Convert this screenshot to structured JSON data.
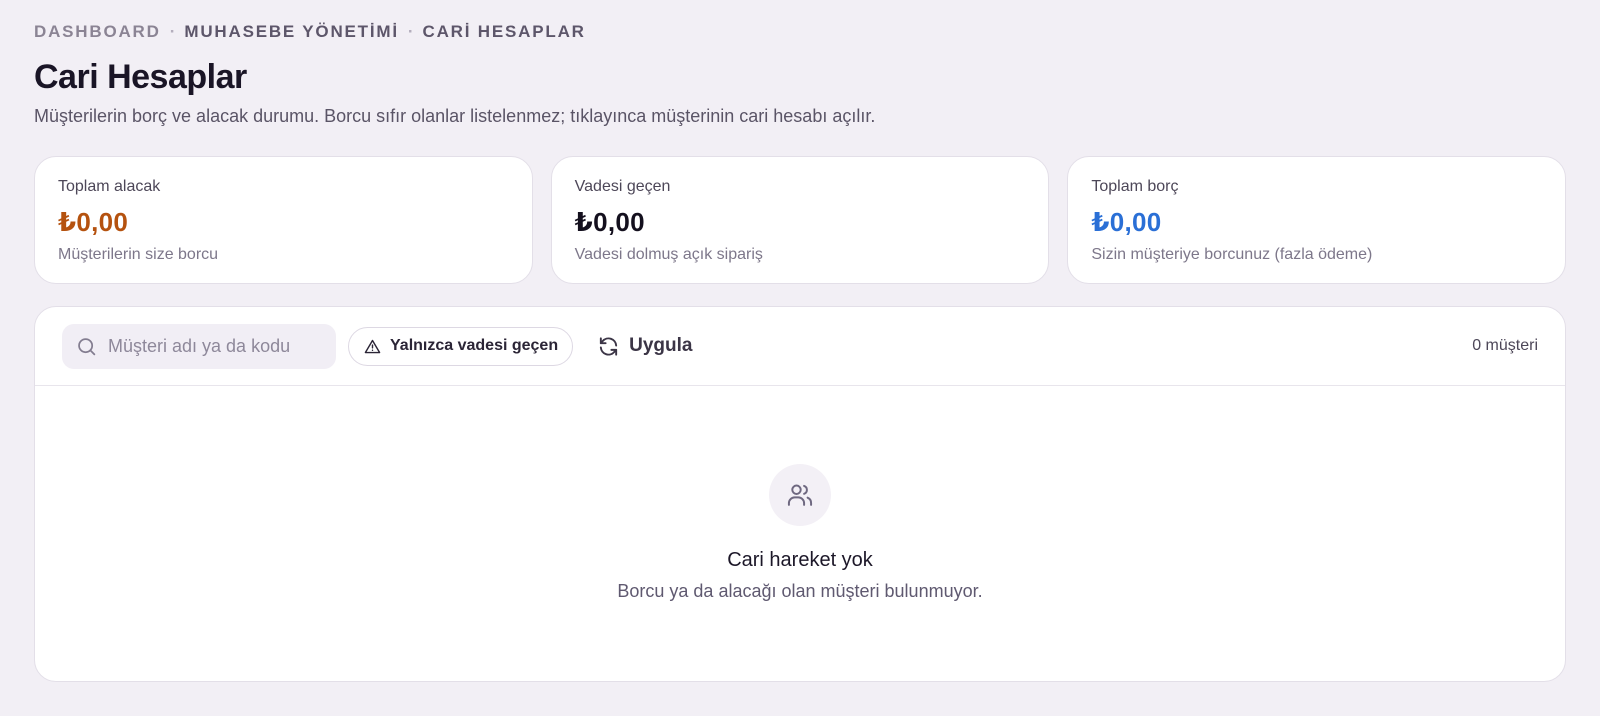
{
  "breadcrumb": {
    "items": [
      "DASHBOARD",
      "MUHASEBE YÖNETİMİ",
      "CARİ HESAPLAR"
    ],
    "separator": "·"
  },
  "header": {
    "title": "Cari Hesaplar",
    "subtitle": "Müşterilerin borç ve alacak durumu. Borcu sıfır olanlar listelenmez; tıklayınca müşterinin cari hesabı açılır."
  },
  "summary_cards": [
    {
      "label": "Toplam alacak",
      "value": "₺0,00",
      "note": "Müşterilerin size borcu",
      "color": "#b5520f"
    },
    {
      "label": "Vadesi geçen",
      "value": "₺0,00",
      "note": "Vadesi dolmuş açık sipariş",
      "color": "#14101e"
    },
    {
      "label": "Toplam borç",
      "value": "₺0,00",
      "note": "Sizin müşteriye borcunuz (fazla ödeme)",
      "color": "#2a6fd6"
    }
  ],
  "toolbar": {
    "search_placeholder": "Müşteri adı ya da kodu",
    "search_value": "",
    "search_icon": "search-icon",
    "overdue_filter_label": "Yalnızca vadesi geçen",
    "overdue_filter_icon": "warning-triangle-icon",
    "apply_label": "Uygula",
    "apply_icon": "refresh-icon",
    "customer_count": "0 müşteri"
  },
  "empty_state": {
    "icon": "users-icon",
    "title": "Cari hareket yok",
    "text": "Borcu ya da alacağı olan müşteri bulunmuyor."
  }
}
